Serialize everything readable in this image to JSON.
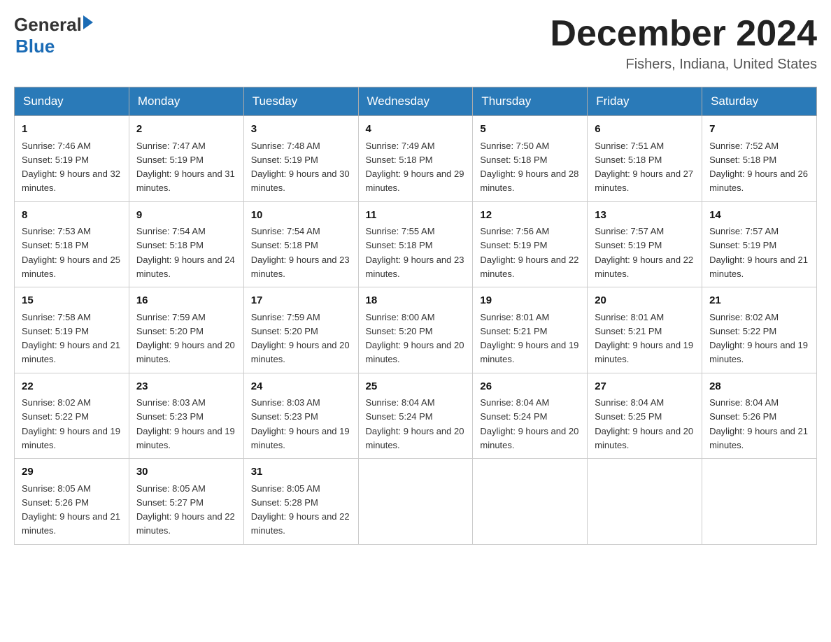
{
  "logo": {
    "general": "General",
    "arrow": "▶",
    "blue": "Blue"
  },
  "title": "December 2024",
  "location": "Fishers, Indiana, United States",
  "days_of_week": [
    "Sunday",
    "Monday",
    "Tuesday",
    "Wednesday",
    "Thursday",
    "Friday",
    "Saturday"
  ],
  "weeks": [
    [
      {
        "day": "1",
        "sunrise": "7:46 AM",
        "sunset": "5:19 PM",
        "daylight": "9 hours and 32 minutes."
      },
      {
        "day": "2",
        "sunrise": "7:47 AM",
        "sunset": "5:19 PM",
        "daylight": "9 hours and 31 minutes."
      },
      {
        "day": "3",
        "sunrise": "7:48 AM",
        "sunset": "5:19 PM",
        "daylight": "9 hours and 30 minutes."
      },
      {
        "day": "4",
        "sunrise": "7:49 AM",
        "sunset": "5:18 PM",
        "daylight": "9 hours and 29 minutes."
      },
      {
        "day": "5",
        "sunrise": "7:50 AM",
        "sunset": "5:18 PM",
        "daylight": "9 hours and 28 minutes."
      },
      {
        "day": "6",
        "sunrise": "7:51 AM",
        "sunset": "5:18 PM",
        "daylight": "9 hours and 27 minutes."
      },
      {
        "day": "7",
        "sunrise": "7:52 AM",
        "sunset": "5:18 PM",
        "daylight": "9 hours and 26 minutes."
      }
    ],
    [
      {
        "day": "8",
        "sunrise": "7:53 AM",
        "sunset": "5:18 PM",
        "daylight": "9 hours and 25 minutes."
      },
      {
        "day": "9",
        "sunrise": "7:54 AM",
        "sunset": "5:18 PM",
        "daylight": "9 hours and 24 minutes."
      },
      {
        "day": "10",
        "sunrise": "7:54 AM",
        "sunset": "5:18 PM",
        "daylight": "9 hours and 23 minutes."
      },
      {
        "day": "11",
        "sunrise": "7:55 AM",
        "sunset": "5:18 PM",
        "daylight": "9 hours and 23 minutes."
      },
      {
        "day": "12",
        "sunrise": "7:56 AM",
        "sunset": "5:19 PM",
        "daylight": "9 hours and 22 minutes."
      },
      {
        "day": "13",
        "sunrise": "7:57 AM",
        "sunset": "5:19 PM",
        "daylight": "9 hours and 22 minutes."
      },
      {
        "day": "14",
        "sunrise": "7:57 AM",
        "sunset": "5:19 PM",
        "daylight": "9 hours and 21 minutes."
      }
    ],
    [
      {
        "day": "15",
        "sunrise": "7:58 AM",
        "sunset": "5:19 PM",
        "daylight": "9 hours and 21 minutes."
      },
      {
        "day": "16",
        "sunrise": "7:59 AM",
        "sunset": "5:20 PM",
        "daylight": "9 hours and 20 minutes."
      },
      {
        "day": "17",
        "sunrise": "7:59 AM",
        "sunset": "5:20 PM",
        "daylight": "9 hours and 20 minutes."
      },
      {
        "day": "18",
        "sunrise": "8:00 AM",
        "sunset": "5:20 PM",
        "daylight": "9 hours and 20 minutes."
      },
      {
        "day": "19",
        "sunrise": "8:01 AM",
        "sunset": "5:21 PM",
        "daylight": "9 hours and 19 minutes."
      },
      {
        "day": "20",
        "sunrise": "8:01 AM",
        "sunset": "5:21 PM",
        "daylight": "9 hours and 19 minutes."
      },
      {
        "day": "21",
        "sunrise": "8:02 AM",
        "sunset": "5:22 PM",
        "daylight": "9 hours and 19 minutes."
      }
    ],
    [
      {
        "day": "22",
        "sunrise": "8:02 AM",
        "sunset": "5:22 PM",
        "daylight": "9 hours and 19 minutes."
      },
      {
        "day": "23",
        "sunrise": "8:03 AM",
        "sunset": "5:23 PM",
        "daylight": "9 hours and 19 minutes."
      },
      {
        "day": "24",
        "sunrise": "8:03 AM",
        "sunset": "5:23 PM",
        "daylight": "9 hours and 19 minutes."
      },
      {
        "day": "25",
        "sunrise": "8:04 AM",
        "sunset": "5:24 PM",
        "daylight": "9 hours and 20 minutes."
      },
      {
        "day": "26",
        "sunrise": "8:04 AM",
        "sunset": "5:24 PM",
        "daylight": "9 hours and 20 minutes."
      },
      {
        "day": "27",
        "sunrise": "8:04 AM",
        "sunset": "5:25 PM",
        "daylight": "9 hours and 20 minutes."
      },
      {
        "day": "28",
        "sunrise": "8:04 AM",
        "sunset": "5:26 PM",
        "daylight": "9 hours and 21 minutes."
      }
    ],
    [
      {
        "day": "29",
        "sunrise": "8:05 AM",
        "sunset": "5:26 PM",
        "daylight": "9 hours and 21 minutes."
      },
      {
        "day": "30",
        "sunrise": "8:05 AM",
        "sunset": "5:27 PM",
        "daylight": "9 hours and 22 minutes."
      },
      {
        "day": "31",
        "sunrise": "8:05 AM",
        "sunset": "5:28 PM",
        "daylight": "9 hours and 22 minutes."
      },
      null,
      null,
      null,
      null
    ]
  ]
}
